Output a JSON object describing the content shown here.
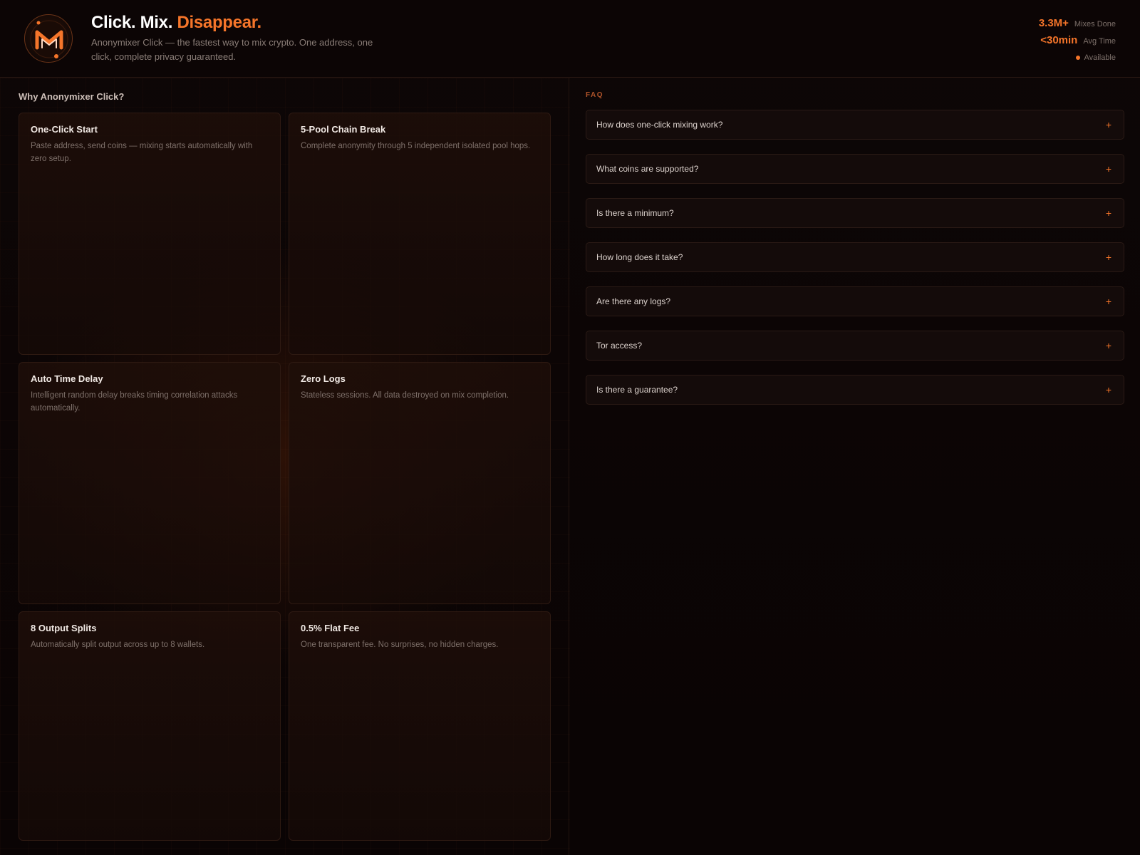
{
  "header": {
    "logo_letter": "M",
    "title_part1": "Click. Mix.",
    "title_accent": "Disappear.",
    "subtitle": "Anonymixer Click — the fastest way to mix crypto. One address, one click, complete privacy guaranteed.",
    "stats": [
      {
        "value": "3.3M+",
        "label": "Mixes Done"
      },
      {
        "value": "<30min",
        "label": "Avg Time"
      }
    ],
    "status_label": "Available"
  },
  "features": {
    "section_title": "Why Anonymixer Click?",
    "items": [
      {
        "title": "One-Click Start",
        "desc": "Paste address, send coins — mixing starts automatically with zero setup."
      },
      {
        "title": "5-Pool Chain Break",
        "desc": "Complete anonymity through 5 independent isolated pool hops."
      },
      {
        "title": "Auto Time Delay",
        "desc": "Intelligent random delay breaks timing correlation attacks automatically."
      },
      {
        "title": "Zero Logs",
        "desc": "Stateless sessions. All data destroyed on mix completion."
      },
      {
        "title": "8 Output Splits",
        "desc": "Automatically split output across up to 8 wallets."
      },
      {
        "title": "0.5% Flat Fee",
        "desc": "One transparent fee. No surprises, no hidden charges."
      }
    ]
  },
  "faq": {
    "label": "FAQ",
    "expand_symbol": "+",
    "items": [
      {
        "q": "How does one-click mixing work?"
      },
      {
        "q": "What coins are supported?"
      },
      {
        "q": "Is there a minimum?"
      },
      {
        "q": "How long does it take?"
      },
      {
        "q": "Are there any logs?"
      },
      {
        "q": "Tor access?"
      },
      {
        "q": "Is there a guarantee?"
      }
    ]
  },
  "colors": {
    "accent": "#f5752a",
    "background": "#0b0505",
    "card_border": "#2e1a12"
  },
  "icons": {
    "logo": "monero-m-logo-icon",
    "status": "status-dot-icon",
    "faq_expand": "plus-icon"
  }
}
